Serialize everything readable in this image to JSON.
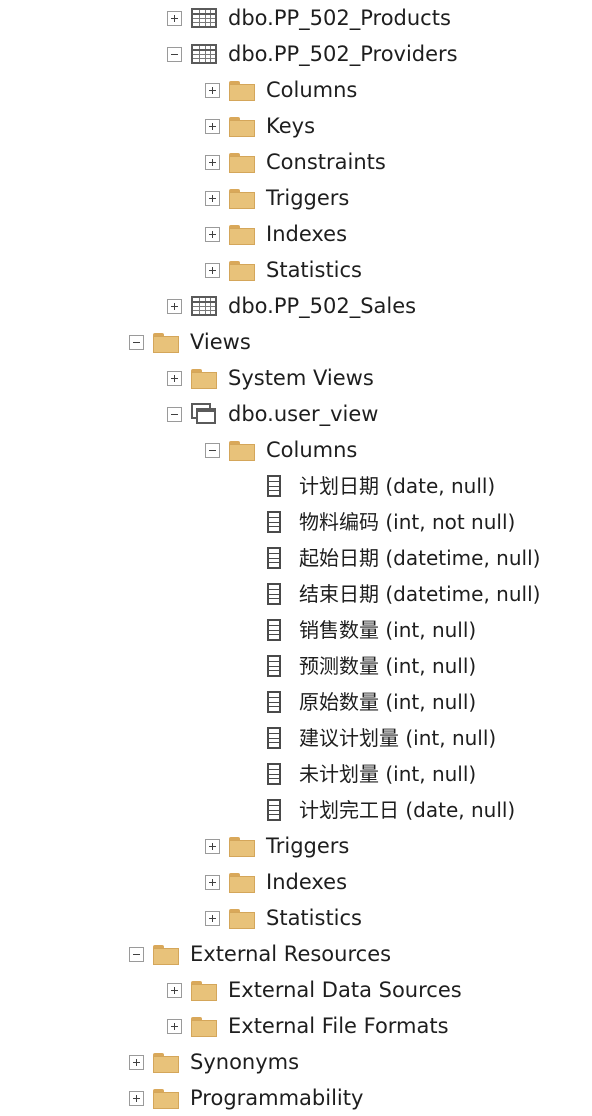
{
  "tree": [
    {
      "label": "dbo.PP_502_Products",
      "icon": "table-icon",
      "level": 2,
      "expander": "collapsed"
    },
    {
      "label": "dbo.PP_502_Providers",
      "icon": "table-icon",
      "level": 2,
      "expander": "expanded"
    },
    {
      "label": "Columns",
      "icon": "folder-icon",
      "level": 3,
      "expander": "collapsed"
    },
    {
      "label": "Keys",
      "icon": "folder-icon",
      "level": 3,
      "expander": "collapsed"
    },
    {
      "label": "Constraints",
      "icon": "folder-icon",
      "level": 3,
      "expander": "collapsed"
    },
    {
      "label": "Triggers",
      "icon": "folder-icon",
      "level": 3,
      "expander": "collapsed"
    },
    {
      "label": "Indexes",
      "icon": "folder-icon",
      "level": 3,
      "expander": "collapsed"
    },
    {
      "label": "Statistics",
      "icon": "folder-icon",
      "level": 3,
      "expander": "collapsed"
    },
    {
      "label": "dbo.PP_502_Sales",
      "icon": "table-icon",
      "level": 2,
      "expander": "collapsed"
    },
    {
      "label": "Views",
      "icon": "folder-icon",
      "level": 1,
      "expander": "expanded"
    },
    {
      "label": "System Views",
      "icon": "folder-icon",
      "level": 2,
      "expander": "collapsed"
    },
    {
      "label": "dbo.user_view",
      "icon": "view-icon",
      "level": 2,
      "expander": "expanded"
    },
    {
      "label": "Columns",
      "icon": "folder-icon",
      "level": 3,
      "expander": "expanded"
    },
    {
      "label": "计划日期 (date, null)",
      "icon": "column-icon",
      "level": 4,
      "expander": "none"
    },
    {
      "label": "物料编码 (int, not null)",
      "icon": "column-icon",
      "level": 4,
      "expander": "none"
    },
    {
      "label": "起始日期 (datetime, null)",
      "icon": "column-icon",
      "level": 4,
      "expander": "none"
    },
    {
      "label": "结束日期 (datetime, null)",
      "icon": "column-icon",
      "level": 4,
      "expander": "none"
    },
    {
      "label": "销售数量 (int, null)",
      "icon": "column-icon",
      "level": 4,
      "expander": "none"
    },
    {
      "label": "预测数量 (int, null)",
      "icon": "column-icon",
      "level": 4,
      "expander": "none"
    },
    {
      "label": "原始数量 (int, null)",
      "icon": "column-icon",
      "level": 4,
      "expander": "none"
    },
    {
      "label": "建议计划量 (int, null)",
      "icon": "column-icon",
      "level": 4,
      "expander": "none"
    },
    {
      "label": "未计划量 (int, null)",
      "icon": "column-icon",
      "level": 4,
      "expander": "none"
    },
    {
      "label": "计划完工日 (date, null)",
      "icon": "column-icon",
      "level": 4,
      "expander": "none"
    },
    {
      "label": "Triggers",
      "icon": "folder-icon",
      "level": 3,
      "expander": "collapsed"
    },
    {
      "label": "Indexes",
      "icon": "folder-icon",
      "level": 3,
      "expander": "collapsed"
    },
    {
      "label": "Statistics",
      "icon": "folder-icon",
      "level": 3,
      "expander": "collapsed"
    },
    {
      "label": "External Resources",
      "icon": "folder-icon",
      "level": 1,
      "expander": "expanded"
    },
    {
      "label": "External Data Sources",
      "icon": "folder-icon",
      "level": 2,
      "expander": "collapsed"
    },
    {
      "label": "External File Formats",
      "icon": "folder-icon",
      "level": 2,
      "expander": "collapsed"
    },
    {
      "label": "Synonyms",
      "icon": "folder-icon",
      "level": 1,
      "expander": "collapsed"
    },
    {
      "label": "Programmability",
      "icon": "folder-icon",
      "level": 1,
      "expander": "collapsed"
    }
  ]
}
